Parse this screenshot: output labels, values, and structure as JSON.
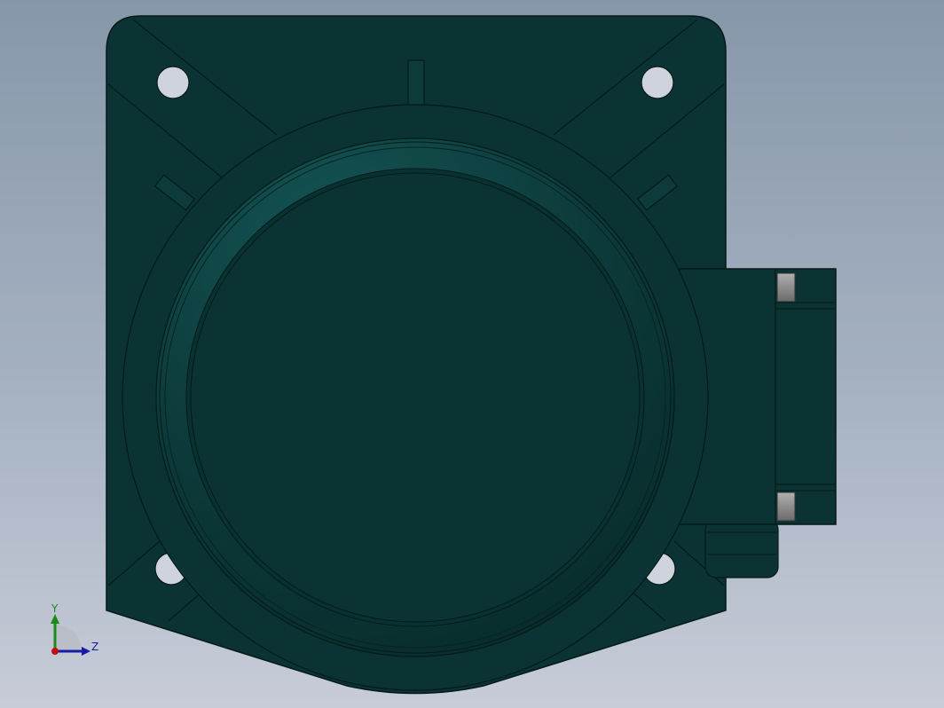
{
  "viewport": {
    "background_top": "#8797aa",
    "background_bottom": "#c7ccd8"
  },
  "model": {
    "body_color": "#0b3333",
    "edge_color": "#041a1a",
    "highlight_color": "#0f4747",
    "tab_color": "#8a8a8a"
  },
  "triad": {
    "y_label": "Y",
    "z_label": "Z",
    "y_color": "#1a8a1a",
    "z_color": "#1a1aa8",
    "origin_color": "#c01010"
  }
}
